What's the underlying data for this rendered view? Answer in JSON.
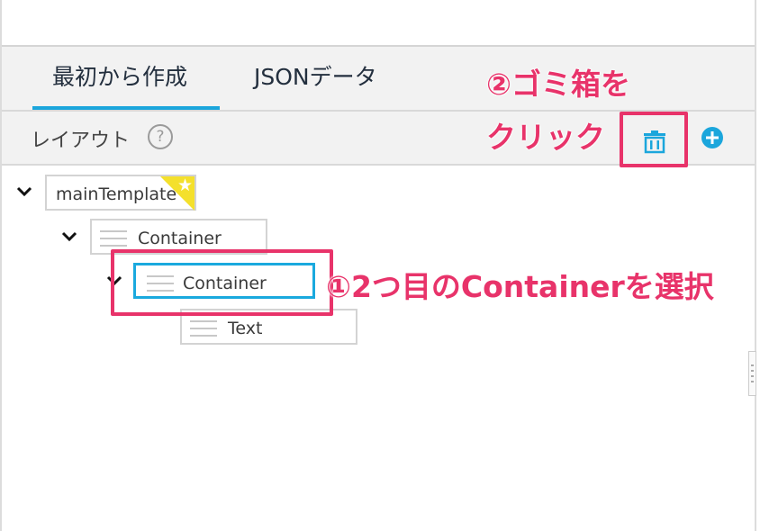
{
  "tabs": [
    "最初から作成",
    "JSONデータ"
  ],
  "toolbar": {
    "layout_label": "レイアウト",
    "help_glyph": "?"
  },
  "tree": {
    "main": "mainTemplate",
    "container1": "Container",
    "container2": "Container",
    "text": "Text"
  },
  "annotations": {
    "step2_line1": "②ゴミ箱を",
    "step2_line2": "クリック",
    "step1": "①2つ目のContainerを選択"
  },
  "colors": {
    "accent": "#1ba6dc",
    "highlight": "#e8336a",
    "star": "#f4e02c"
  }
}
